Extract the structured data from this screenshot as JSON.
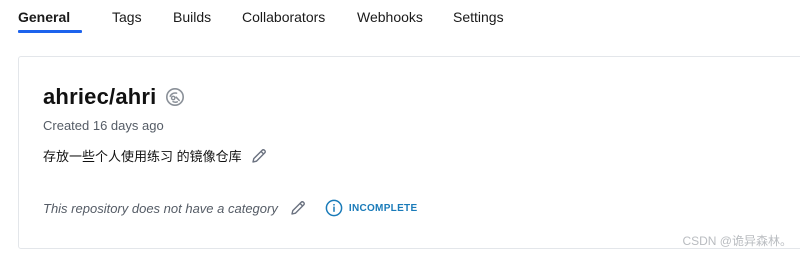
{
  "tabs": [
    {
      "label": "General",
      "active": true
    },
    {
      "label": "Tags"
    },
    {
      "label": "Builds"
    },
    {
      "label": "Collaborators"
    },
    {
      "label": "Webhooks"
    },
    {
      "label": "Settings"
    }
  ],
  "repo": {
    "name": "ahriec/ahri",
    "visibility_icon": "private-repo-icon",
    "created": "Created 16 days ago",
    "description": "存放一些个人使用练习 的镜像仓库",
    "category_text": "This repository does not have a category",
    "status_label": "INCOMPLETE"
  },
  "watermark": "CSDN @诡异森林。",
  "colors": {
    "accent": "#1d63ed",
    "status": "#1a7bb9",
    "muted": "#555c66"
  }
}
